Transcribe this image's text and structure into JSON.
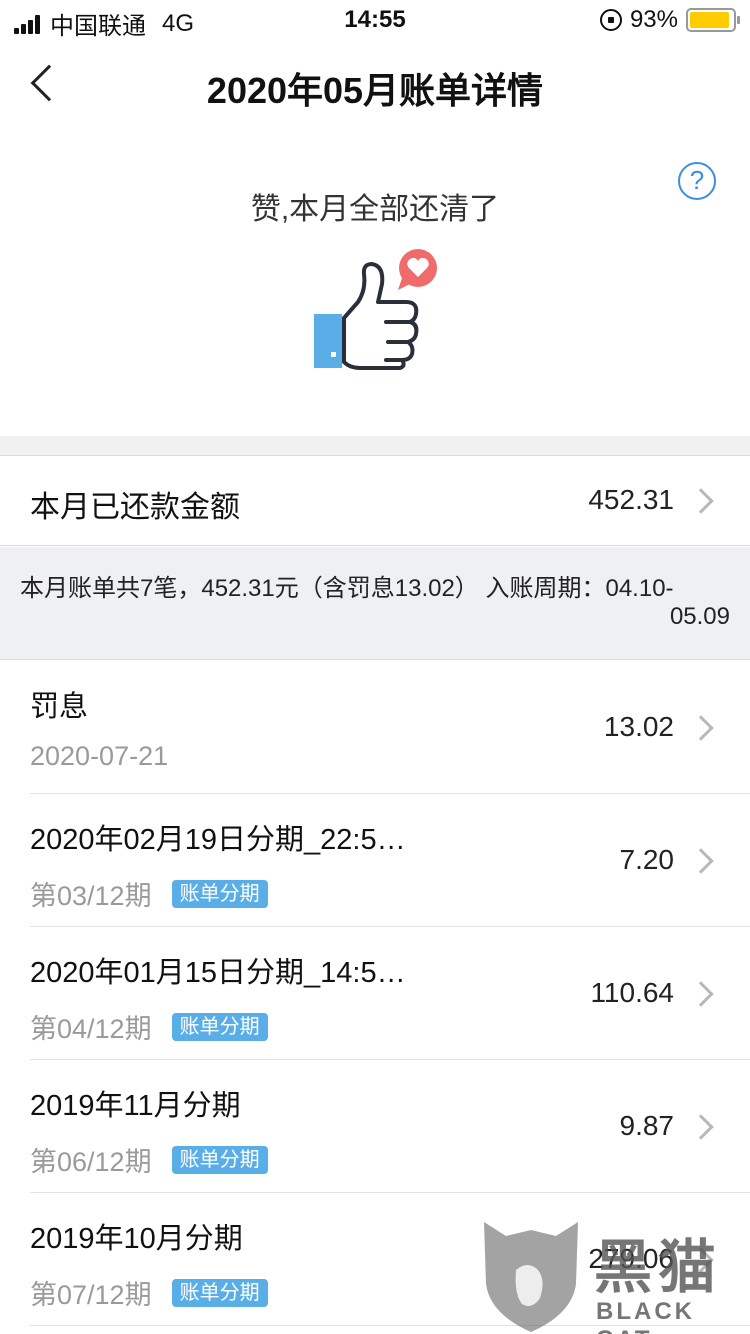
{
  "status_bar": {
    "carrier": "中国联通",
    "network": "4G",
    "time": "14:55",
    "battery_percent": "93%",
    "battery_level": 0.93
  },
  "nav": {
    "title": "2020年05月账单详情"
  },
  "hero": {
    "message": "赞,本月全部还清了",
    "help_symbol": "?"
  },
  "paid": {
    "label": "本月已还款金额",
    "amount": "452.31"
  },
  "summary": {
    "text_line1": "本月账单共7笔，452.31元（含罚息13.02） 入账周期：04.10-",
    "text_line2": "05.09"
  },
  "items": [
    {
      "title": "罚息",
      "subtitle": "2020-07-21",
      "badge": "",
      "amount": "13.02"
    },
    {
      "title": "2020年02月19日分期_22:5…",
      "subtitle": "第03/12期",
      "badge": "账单分期",
      "amount": "7.20"
    },
    {
      "title": "2020年01月15日分期_14:5…",
      "subtitle": "第04/12期",
      "badge": "账单分期",
      "amount": "110.64"
    },
    {
      "title": "2019年11月分期",
      "subtitle": "第06/12期",
      "badge": "账单分期",
      "amount": "9.87"
    },
    {
      "title": "2019年10月分期",
      "subtitle": "第07/12期",
      "badge": "账单分期",
      "amount": "279.06"
    }
  ],
  "watermark": {
    "cn": "黑猫",
    "en": "BLACK CAT"
  },
  "colors": {
    "accent_blue": "#3a8ee6",
    "badge_blue": "#5aaee8",
    "heart_red": "#f06b6b",
    "battery_yellow": "#ffcc00"
  }
}
